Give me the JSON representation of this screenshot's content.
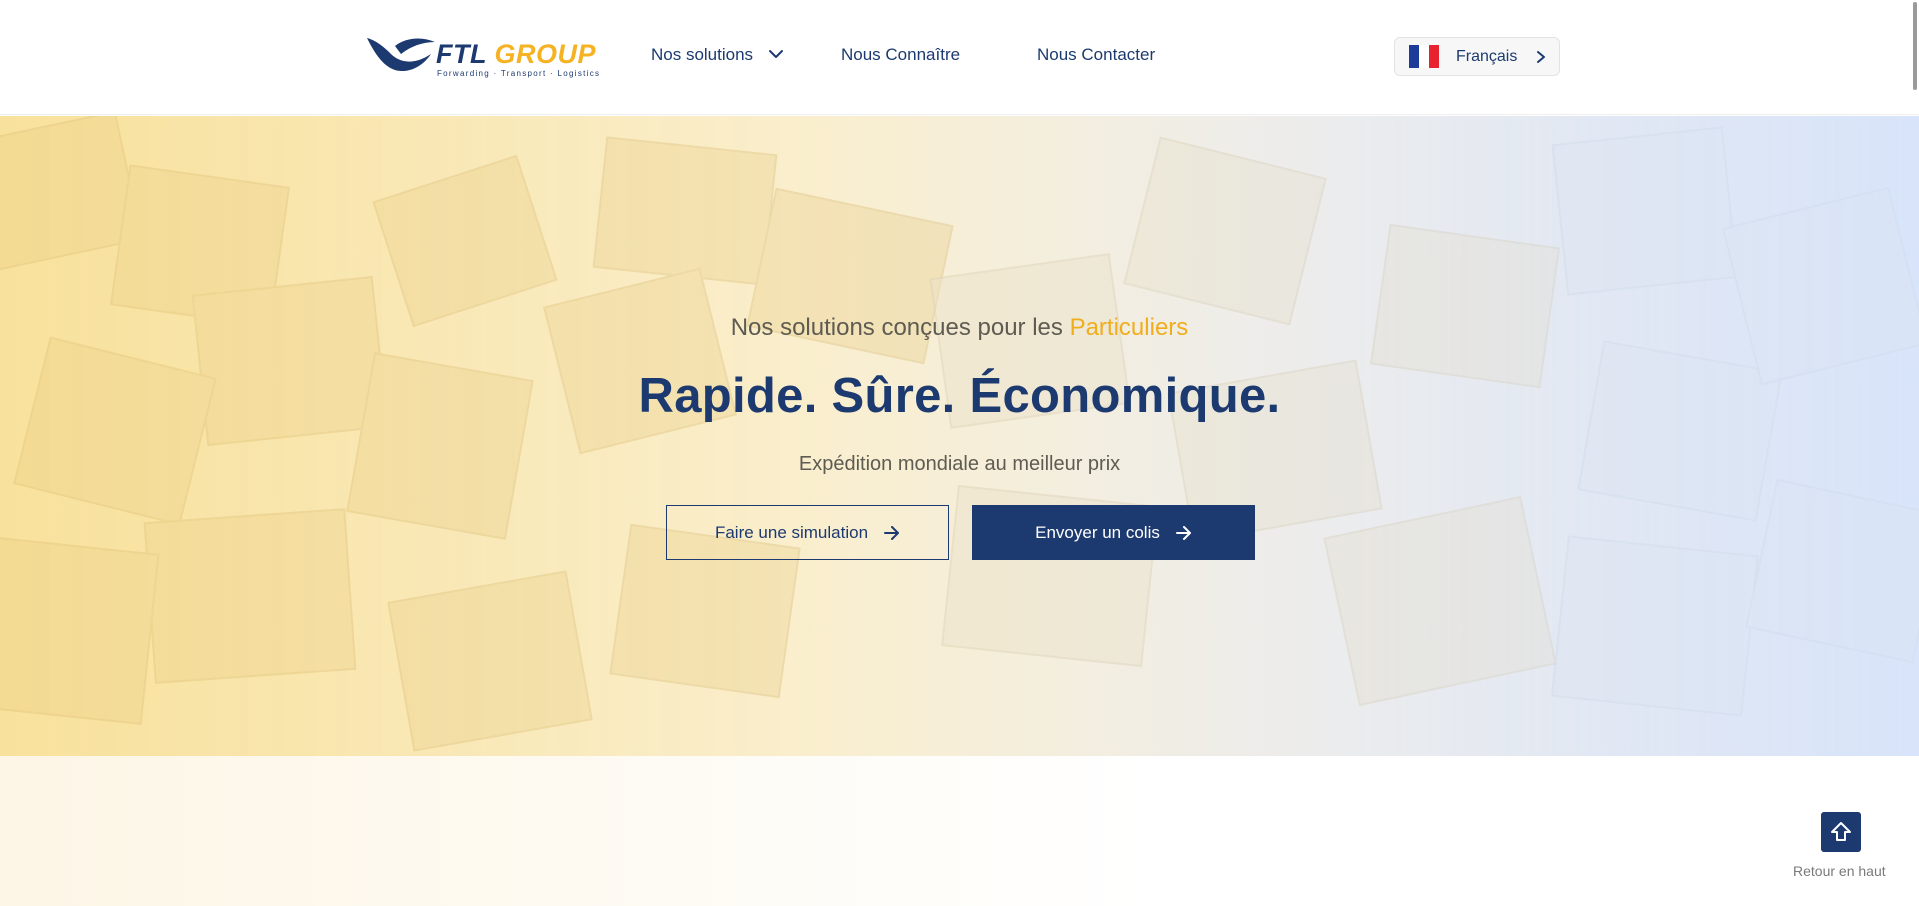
{
  "brand": {
    "name_primary": "FTL",
    "name_secondary": "GROUP",
    "tagline": "Forwarding · Transport · Logistics",
    "colors": {
      "navy": "#1c3a70",
      "gold": "#f5b324"
    }
  },
  "nav": {
    "items": [
      {
        "label": "Nos solutions",
        "has_dropdown": true,
        "icon": "chevron-down-icon"
      },
      {
        "label": "Nous Connaître"
      },
      {
        "label": "Nous Contacter"
      }
    ]
  },
  "language": {
    "label": "Français",
    "flag_icon": "france-flag-icon",
    "chevron_icon": "chevron-right-icon"
  },
  "hero": {
    "subtitle_prefix": "Nos solutions conçues pour les",
    "subtitle_highlight": "Particuliers",
    "title": "Rapide. Sûre. Économique.",
    "tagline": "Expédition mondiale au meilleur prix",
    "buttons": [
      {
        "label": "Faire une simulation",
        "style": "outline",
        "icon": "arrow-right-icon"
      },
      {
        "label": "Envoyer un colis",
        "style": "primary",
        "icon": "arrow-right-icon"
      }
    ]
  },
  "back_to_top": {
    "label": "Retour en haut",
    "icon": "arrow-up-icon"
  }
}
